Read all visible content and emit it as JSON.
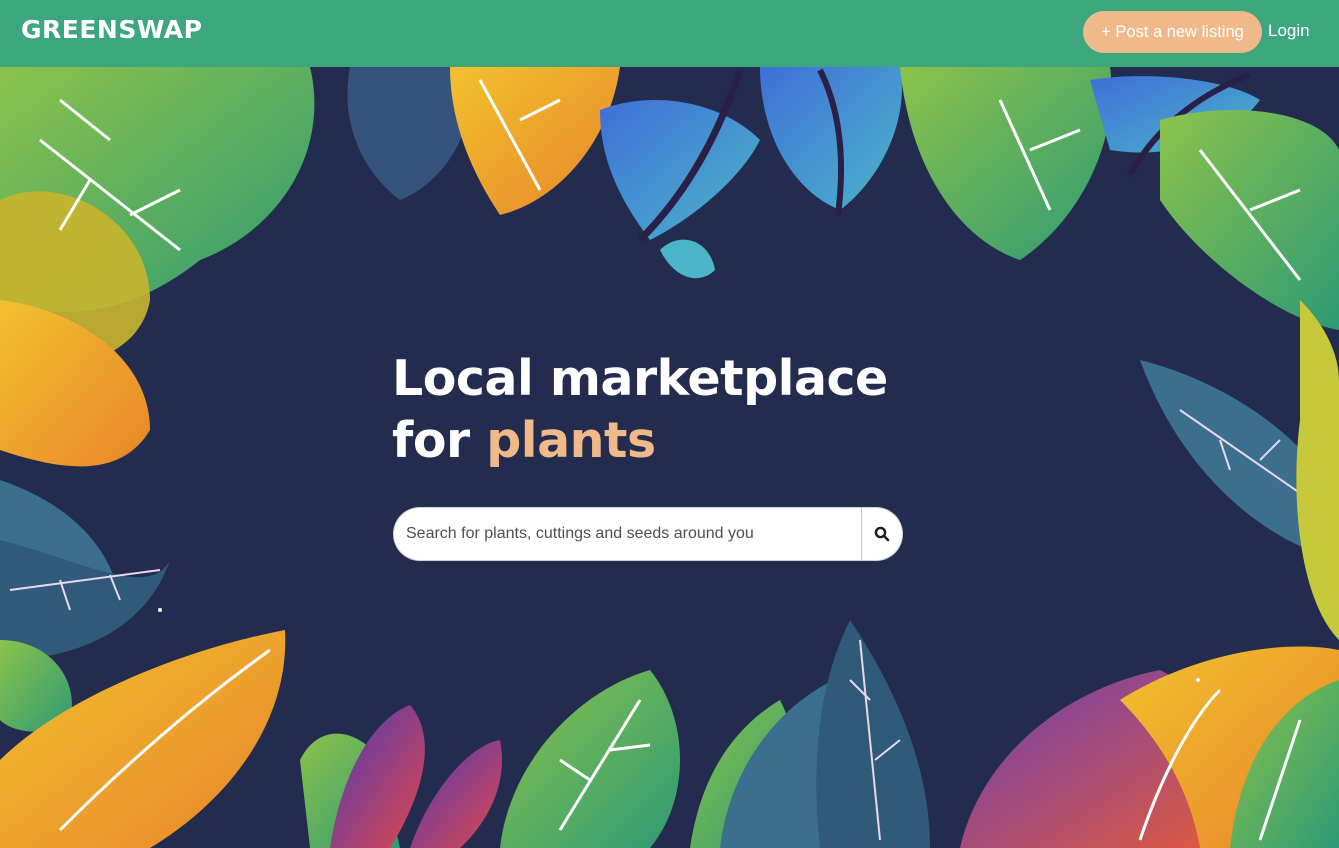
{
  "header": {
    "logo_text": "GREENSWAP",
    "post_listing_label": "+ Post a new listing",
    "login_label": "Login"
  },
  "hero": {
    "line1": "Local marketplace",
    "line2_prefix": "for",
    "line2_accent": "plants"
  },
  "search": {
    "placeholder": "Search for plants, cuttings and seeds around you",
    "value": "",
    "button_icon": "search-icon"
  },
  "colors": {
    "topbar": "#3ca67c",
    "background": "#232c4f",
    "accent": "#f0b98a",
    "text": "#ffffff"
  }
}
